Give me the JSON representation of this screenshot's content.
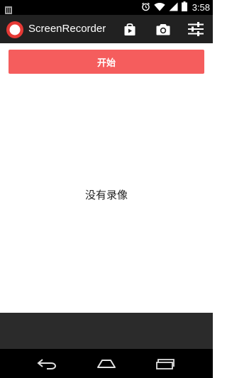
{
  "status_bar": {
    "time": "3:58",
    "icons": [
      "notification-icon",
      "alarm-icon",
      "wifi-icon",
      "signal-icon",
      "battery-icon"
    ]
  },
  "action_bar": {
    "title": "ScreenRecorder",
    "logo": "record-icon",
    "actions": [
      {
        "icon": "store-icon"
      },
      {
        "icon": "camera-icon"
      },
      {
        "icon": "settings-sliders-icon"
      }
    ]
  },
  "main": {
    "start_label": "开始",
    "empty_message": "没有录像"
  },
  "navigation": {
    "buttons": [
      "back-icon",
      "home-icon",
      "recents-icon"
    ]
  },
  "colors": {
    "accent": "#f55d5d",
    "action_bar": "#212121",
    "status_bar": "#000000",
    "logo_red": "#e53935"
  }
}
